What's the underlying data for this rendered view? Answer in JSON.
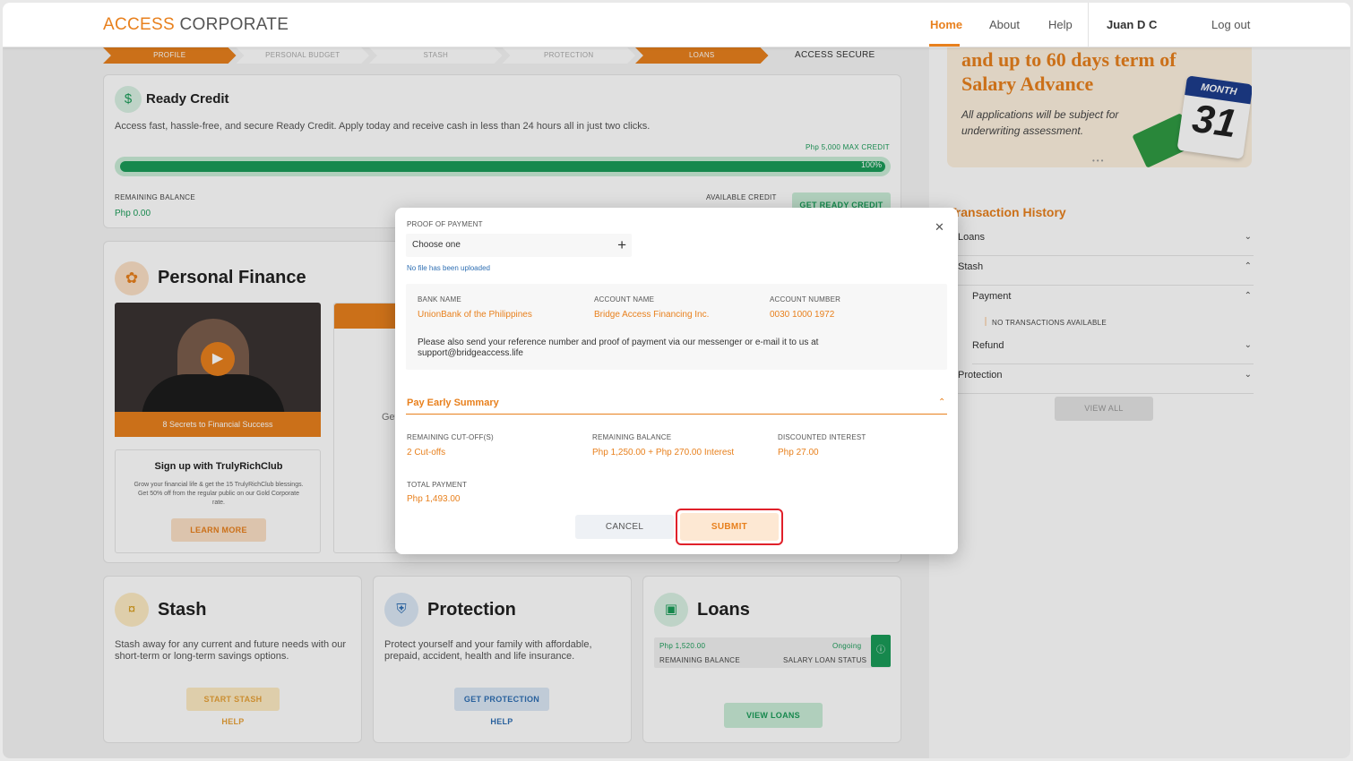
{
  "header": {
    "logo_part1": "ACCESS",
    "logo_part2": "CORPORATE",
    "nav": [
      "Home",
      "About",
      "Help"
    ],
    "user": "Juan D C",
    "logout": "Log out"
  },
  "steps": [
    "PROFILE",
    "PERSONAL BUDGET",
    "STASH",
    "PROTECTION",
    "LOANS",
    "ACCESS SECURE"
  ],
  "ready_credit": {
    "title": "Ready Credit",
    "description": "Access fast, hassle-free, and secure Ready Credit. Apply today and receive cash in less than 24 hours all in just two clicks.",
    "max_credit": "Php 5,000 MAX CREDIT",
    "progress_percent": 100,
    "progress_label": "100%",
    "remaining_balance_label": "REMAINING BALANCE",
    "remaining_balance": "Php 0.00",
    "available_credit_label": "AVAILABLE CREDIT",
    "cta": "GET READY CREDIT"
  },
  "personal_finance": {
    "title": "Personal Finance",
    "video_caption": "8 Secrets to Financial Success",
    "signup_title": "Sign up with TrulyRichClub",
    "signup_text": "Grow your financial life & get the 15 TrulyRichClub blessings. Get 50% off from the regular public on our Gold Corporate rate.",
    "learn_more": "LEARN MORE",
    "partial_text": "Get"
  },
  "stash": {
    "title": "Stash",
    "description": "Stash away for any current and future needs with our short-term or long-term savings options.",
    "cta": "START STASH",
    "help": "HELP"
  },
  "protection": {
    "title": "Protection",
    "description": "Protect yourself and your family with affordable, prepaid, accident, health and life insurance.",
    "cta": "GET PROTECTION",
    "help": "HELP"
  },
  "loans": {
    "title": "Loans",
    "amount": "Php 1,520.00",
    "status": "Ongoing",
    "remaining_label": "REMAINING BALANCE",
    "status_label": "SALARY LOAN STATUS",
    "cta": "VIEW LOANS"
  },
  "banner": {
    "title": "and up to 60 days term of Salary Advance",
    "subtitle": "All applications will be subject for underwriting assessment.",
    "calendar_month": "MONTH",
    "calendar_day": "31"
  },
  "transaction_history": {
    "title": "Transaction History",
    "rows": [
      {
        "label": "Loans",
        "chev": "⌄"
      },
      {
        "label": "Stash",
        "chev": "⌃"
      },
      {
        "label": "Payment",
        "chev": "⌃"
      },
      {
        "label": "Refund",
        "chev": "⌄"
      },
      {
        "label": "Protection",
        "chev": "⌄"
      }
    ],
    "no_transactions": "NO TRANSACTIONS AVAILABLE",
    "view_all": "VIEW ALL"
  },
  "modal": {
    "proof_label": "PROOF OF PAYMENT",
    "choose": "Choose one",
    "no_file": "No file has been uploaded",
    "bank_name_label": "BANK NAME",
    "bank_name": "UnionBank of the Philippines",
    "account_name_label": "ACCOUNT NAME",
    "account_name": "Bridge Access Financing Inc.",
    "account_number_label": "ACCOUNT NUMBER",
    "account_number": "0030 1000 1972",
    "note": "Please also send your reference number and proof of payment via our messenger or e-mail it to us at support@bridgeaccess.life",
    "summary_title": "Pay Early Summary",
    "cutoff_label": "REMAINING CUT-OFF(S)",
    "cutoff": "2 Cut-offs",
    "remaining_label": "REMAINING BALANCE",
    "remaining": "Php 1,250.00 + Php 270.00 Interest",
    "discount_label": "DISCOUNTED INTEREST",
    "discount": "Php 27.00",
    "total_label": "TOTAL PAYMENT",
    "total": "Php 1,493.00",
    "cancel": "CANCEL",
    "submit": "SUBMIT"
  }
}
